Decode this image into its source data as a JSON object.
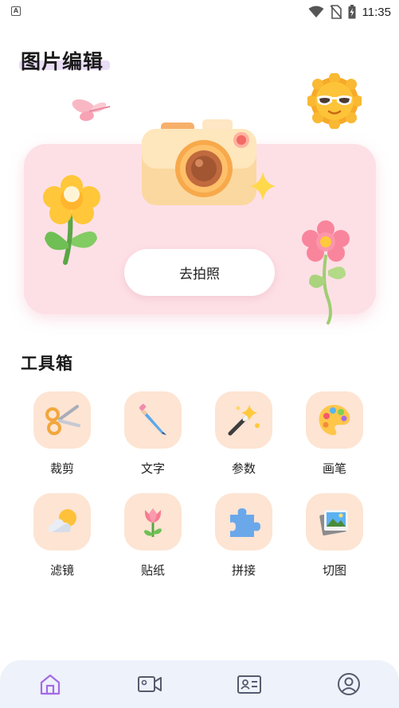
{
  "status_bar": {
    "time": "11:35",
    "notification_icon": "A"
  },
  "header": {
    "title": "图片编辑"
  },
  "hero": {
    "button_label": "去拍照"
  },
  "toolbox": {
    "title": "工具箱",
    "tools": [
      {
        "label": "裁剪",
        "icon": "scissors-icon"
      },
      {
        "label": "文字",
        "icon": "pen-icon"
      },
      {
        "label": "参数",
        "icon": "magic-wand-icon"
      },
      {
        "label": "画笔",
        "icon": "palette-icon"
      },
      {
        "label": "滤镜",
        "icon": "weather-icon"
      },
      {
        "label": "贴纸",
        "icon": "tulip-icon"
      },
      {
        "label": "拼接",
        "icon": "puzzle-icon"
      },
      {
        "label": "切图",
        "icon": "photo-icon"
      }
    ]
  },
  "bottom_nav": {
    "items": [
      {
        "icon": "home-icon",
        "active": true
      },
      {
        "icon": "video-icon",
        "active": false
      },
      {
        "icon": "id-card-icon",
        "active": false
      },
      {
        "icon": "profile-icon",
        "active": false
      }
    ],
    "active_color": "#a46be6",
    "inactive_color": "#555b6e"
  },
  "colors": {
    "hero_background": "#fde0e6",
    "tool_tile": "#fde4d3"
  }
}
